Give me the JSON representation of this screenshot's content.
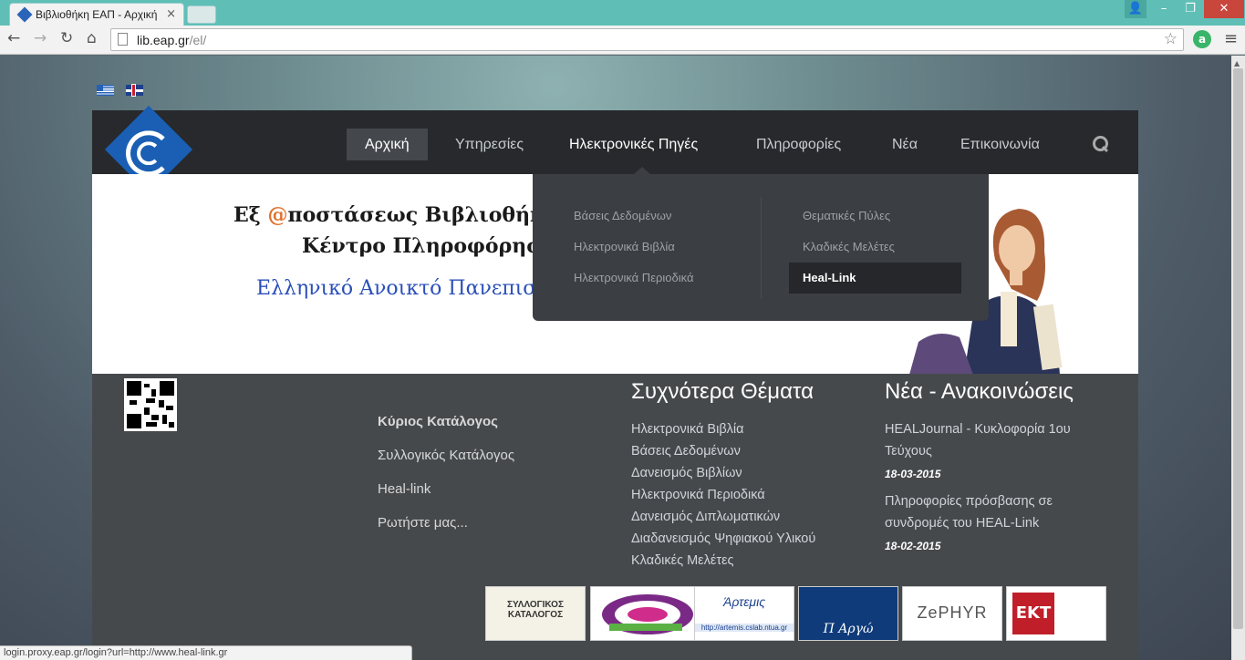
{
  "browser": {
    "tab_title": "Βιβλιοθήκη ΕΑΠ - Αρχική",
    "tab_close": "×",
    "url_host": "lib.eap.gr",
    "url_path": "/el/",
    "status_url": "login.proxy.eap.gr/login?url=http://www.heal-link.gr",
    "icons": [
      "back-icon",
      "forward-icon",
      "reload-icon",
      "home-icon",
      "star-icon",
      "extension-icon",
      "menu-icon"
    ]
  },
  "languages": [
    "el",
    "en"
  ],
  "nav": {
    "items": [
      "Αρχική",
      "Υπηρεσίες",
      "Ηλεκτρονικές Πηγές",
      "Πληροφορίες",
      "Νέα",
      "Επικοινωνία"
    ],
    "active": "Αρχική",
    "open": "Ηλεκτρονικές Πηγές"
  },
  "dropdown": {
    "col1": [
      "Βάσεις Δεδομένων",
      "Ηλεκτρονικά Βιβλία",
      "Ηλεκτρονικά Περιοδικά"
    ],
    "col2": [
      "Θεματικές Πύλες",
      "Κλαδικές Μελέτες",
      "Heal-Link"
    ],
    "highlighted": "Heal-Link"
  },
  "banner": {
    "line1_prefix": "Εξ ",
    "line1_at": "@",
    "line1_rest": "ποστάσεως Βιβλιοθήκη &",
    "line2": "Κέντρο Πληροφόρηση",
    "line3": "Ελληνικό Ανοικτό Πανεπιστ"
  },
  "footer": {
    "links": [
      "Κύριος Κατάλογος",
      "Συλλογικός Κατάλογος",
      "Heal-link",
      "Ρωτήστε μας..."
    ],
    "topics_title": "Συχνότερα Θέματα",
    "topics": [
      "Ηλεκτρονικά Βιβλία",
      "Βάσεις Δεδομένων",
      "Δανεισμός Βιβλίων",
      "Ηλεκτρονικά Περιοδικά",
      "Δανεισμός Διπλωματικών",
      "Διαδανεισμός Ψηφιακού Υλικού",
      "Κλαδικές Μελέτες"
    ],
    "news_title": "Νέα - Ανακοινώσεις",
    "news": [
      {
        "title": "HEALJournal - Κυκλοφορία 1ου Τεύχους",
        "date": "18-03-2015"
      },
      {
        "title": "Πληροφορίες πρόσβασης σε συνδρομές του HEAL-Link",
        "date": "18-02-2015"
      }
    ],
    "partners": [
      {
        "label": "ΣΥΛΛΟΓΙΚΟΣ ΚΑΤΑΛΟΓΟΣ"
      },
      {
        "label": ""
      },
      {
        "label": "Άρτεμις",
        "sub": "http://artemis.cslab.ntua.gr"
      },
      {
        "label": "Π Αργώ"
      },
      {
        "label": "ZePHYR"
      },
      {
        "label": "ΕΚΤ"
      }
    ]
  },
  "colors": {
    "nav_bg": "#27292c",
    "footer_bg": "#46494c",
    "dropdown_bg": "#3b3e42",
    "accent_blue": "#1a5fb4",
    "at_orange": "#e0702c"
  }
}
